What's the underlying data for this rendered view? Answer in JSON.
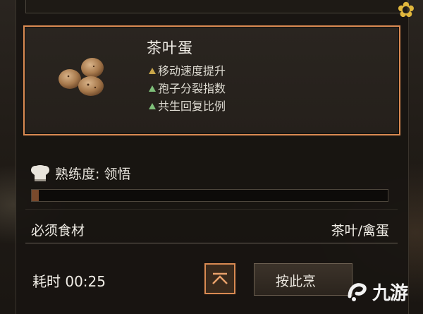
{
  "recipe": {
    "name": "茶叶蛋",
    "image": "tea-eggs",
    "attributes": [
      {
        "label": "移动速度提升",
        "tone": "neutral"
      },
      {
        "label": "孢子分裂指数",
        "tone": "up"
      },
      {
        "label": "共生回复比例",
        "tone": "up"
      }
    ]
  },
  "mastery": {
    "label": "熟练度: 领悟",
    "icon": "chef-hat-icon",
    "progress": 0.02
  },
  "ingredients": {
    "label": "必须食材",
    "value": "茶叶/禽蛋"
  },
  "time": {
    "label": "耗时 00:25"
  },
  "actions": {
    "collapse_icon": "collapse-icon",
    "cook_label": "按此烹"
  },
  "watermark": {
    "text": "九游"
  },
  "colors": {
    "accent": "#d98a52",
    "buff_neutral": "#c9a64a",
    "buff_up": "#7fc07a",
    "corner": "#e0b63c"
  }
}
